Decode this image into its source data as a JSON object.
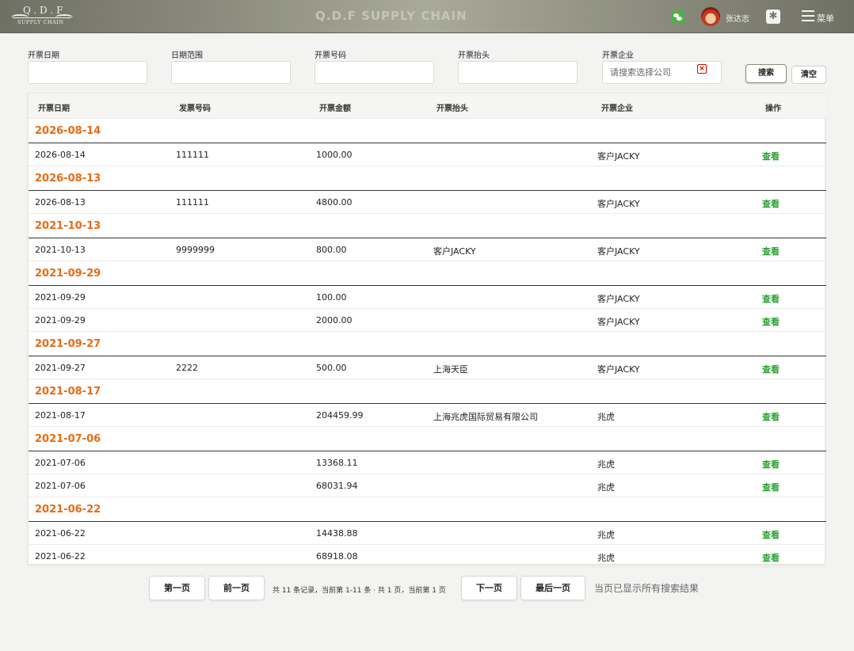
{
  "header": {
    "logo_line1": "Q.D.F",
    "logo_line2": "SUPPLY CHAIN",
    "brand": "Q.D.F SUPPLY CHAIN",
    "username": "张达志",
    "menu_label": "菜单"
  },
  "filters": {
    "invoice_date_label": "开票日期",
    "date_range_label": "日期范围",
    "invoice_no_label": "开票号码",
    "invoice_title_label": "开票抬头",
    "company_label": "开票企业",
    "company_placeholder": "请搜索选择公司",
    "search_label": "搜索",
    "clear_label": "清空"
  },
  "table": {
    "columns": [
      "开票日期",
      "发票号码",
      "开票金额",
      "开票抬头",
      "开票企业",
      "操作"
    ],
    "view_label": "查看",
    "groups": [
      {
        "date": "2026-08-14",
        "rows": [
          {
            "date": "2026-08-14",
            "number": "111111",
            "amount": "1000.00",
            "title": "",
            "company": "客户JACKY"
          }
        ]
      },
      {
        "date": "2026-08-13",
        "rows": [
          {
            "date": "2026-08-13",
            "number": "111111",
            "amount": "4800.00",
            "title": "",
            "company": "客户JACKY"
          }
        ]
      },
      {
        "date": "2021-10-13",
        "rows": [
          {
            "date": "2021-10-13",
            "number": "9999999",
            "amount": "800.00",
            "title": "客户JACKY",
            "company": "客户JACKY"
          }
        ]
      },
      {
        "date": "2021-09-29",
        "rows": [
          {
            "date": "2021-09-29",
            "number": "",
            "amount": "100.00",
            "title": "",
            "company": "客户JACKY"
          },
          {
            "date": "2021-09-29",
            "number": "",
            "amount": "2000.00",
            "title": "",
            "company": "客户JACKY"
          }
        ]
      },
      {
        "date": "2021-09-27",
        "rows": [
          {
            "date": "2021-09-27",
            "number": "2222",
            "amount": "500.00",
            "title": "上海天臣",
            "company": "客户JACKY"
          }
        ]
      },
      {
        "date": "2021-08-17",
        "rows": [
          {
            "date": "2021-08-17",
            "number": "",
            "amount": "204459.99",
            "title": "上海兆虎国际贸易有限公司",
            "company": "兆虎"
          }
        ]
      },
      {
        "date": "2021-07-06",
        "rows": [
          {
            "date": "2021-07-06",
            "number": "",
            "amount": "13368.11",
            "title": "",
            "company": "兆虎"
          },
          {
            "date": "2021-07-06",
            "number": "",
            "amount": "68031.94",
            "title": "",
            "company": "兆虎"
          }
        ]
      },
      {
        "date": "2021-06-22",
        "rows": [
          {
            "date": "2021-06-22",
            "number": "",
            "amount": "14438.88",
            "title": "",
            "company": "兆虎"
          },
          {
            "date": "2021-06-22",
            "number": "",
            "amount": "68918.08",
            "title": "",
            "company": "兆虎"
          }
        ]
      }
    ]
  },
  "pagination": {
    "first": "第一页",
    "prev": "前一页",
    "info": "共 11 条记录，当前第 1-11 条 · 共 1 页，当前第 1 页",
    "next": "下一页",
    "last": "最后一页",
    "done": "当页已显示所有搜索结果"
  },
  "colors": {
    "date_group": "#ea6a12",
    "action_link": "#2fa334",
    "header_bg": "#8a8b7c"
  },
  "icons": [
    "wechat-icon",
    "avatar",
    "settings-icon",
    "menu-icon",
    "clear-icon"
  ]
}
